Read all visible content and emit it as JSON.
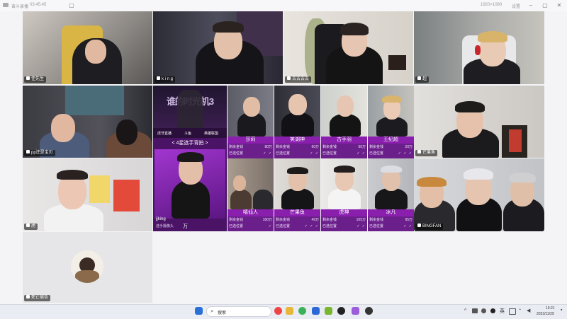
{
  "window": {
    "app_title": "奋斗录播",
    "time_counter": "03:45:45",
    "top_right_1": "1920×1080",
    "top_right_2": "设置"
  },
  "top_row": [
    {
      "name": "佳先生"
    },
    {
      "name": "k i n g"
    },
    {
      "name": "古古古古"
    },
    {
      "name": "超"
    }
  ],
  "left_tiles": [
    {
      "name": "pp还是宝贝"
    },
    {
      "name": "虎"
    },
    {
      "name": "死亡宿告"
    }
  ],
  "right_tiles": [
    {
      "name": "芒果鱼"
    },
    {
      "name": "BINGFAN"
    }
  ],
  "center_panel": {
    "banner_text": "谁的时光机3",
    "sponsors": [
      "虎牙直播",
      "斗鱼",
      "英雄联盟"
    ],
    "section_title": "< 4星选手背拍 >",
    "player_name": "jjking",
    "player_tag": "选手摄像头",
    "player_value": "万"
  },
  "cards_row1": [
    {
      "name": "莎莉",
      "money_label": "剩余金钱",
      "money": "80万",
      "picked_label": "已选位置",
      "checks": "✓ ✓"
    },
    {
      "name": "笑湖神",
      "money_label": "剩余金钱",
      "money": "60万",
      "picked_label": "已选位置",
      "checks": "✓ ✓"
    },
    {
      "name": "古手羽",
      "money_label": "剩余金钱",
      "money": "60万",
      "picked_label": "已选位置",
      "checks": "✓ ✓"
    },
    {
      "name": "王纪超",
      "money_label": "剩余金钱",
      "money": "20万",
      "picked_label": "已选位置",
      "checks": "✓ ✓ ✓"
    }
  ],
  "cards_row2": [
    {
      "name": "嘻仙人",
      "money_label": "剩余金钱",
      "money": "180万",
      "picked_label": "已选位置",
      "checks": "✓"
    },
    {
      "name": "芒果鱼",
      "money_label": "剩余金钱",
      "money": "49万",
      "picked_label": "已选位置",
      "checks": "✓ ✓ ✓"
    },
    {
      "name": "虎神",
      "money_label": "剩余金钱",
      "money": "105万",
      "picked_label": "已选位置",
      "checks": "✓ ✓"
    },
    {
      "name": "冰凡",
      "money_label": "剩余金钱",
      "money": "95万",
      "picked_label": "已选位置",
      "checks": "✓ ✓"
    }
  ],
  "taskbar": {
    "search_placeholder": "搜索",
    "ime": "英",
    "time": "19:21",
    "date": "2023/11/29"
  }
}
